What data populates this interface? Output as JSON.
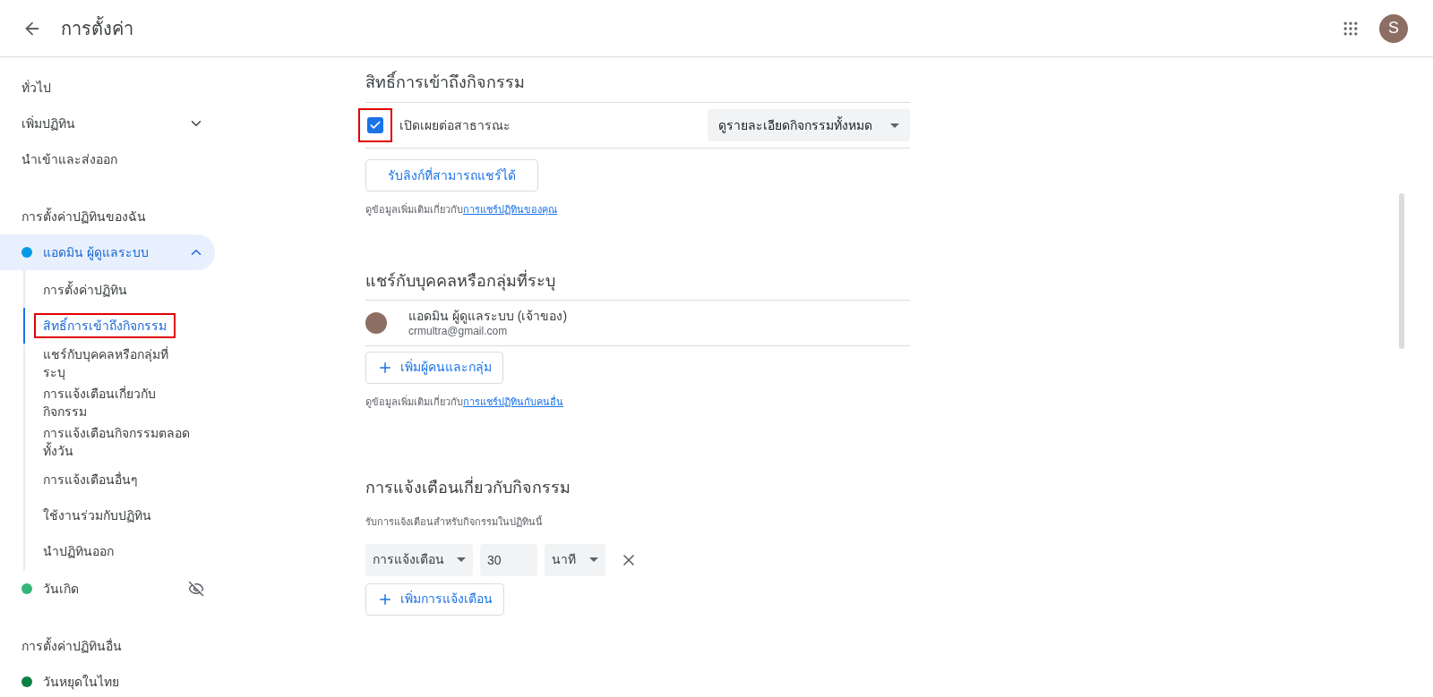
{
  "header": {
    "title": "การตั้งค่า",
    "avatar_letter": "S"
  },
  "sidebar": {
    "top_items": [
      {
        "label": "ทั่วไป",
        "expandable": false
      },
      {
        "label": "เพิ่มปฏิทิน",
        "expandable": true
      },
      {
        "label": "นำเข้าและส่งออก",
        "expandable": false
      }
    ],
    "my_calendars": {
      "heading": "การตั้งค่าปฏิทินของฉัน",
      "calendars": [
        {
          "label": "แอดมิน ผู้ดูแลระบบ",
          "color": "#039be5",
          "expanded": true,
          "hidden": false,
          "children": [
            {
              "label": "การตั้งค่าปฏิทิน",
              "selected": false,
              "highlighted": false
            },
            {
              "label": "สิทธิ์การเข้าถึงกิจกรรม",
              "selected": true,
              "highlighted": true
            },
            {
              "label": "แชร์กับบุคคลหรือกลุ่มที่ระบุ",
              "selected": false,
              "highlighted": false
            },
            {
              "label": "การแจ้งเตือนเกี่ยวกับกิจกรรม",
              "selected": false,
              "highlighted": false
            },
            {
              "label": "การแจ้งเตือนกิจกรรมตลอดทั้งวัน",
              "selected": false,
              "highlighted": false
            },
            {
              "label": "การแจ้งเตือนอื่นๆ",
              "selected": false,
              "highlighted": false
            },
            {
              "label": "ใช้งานร่วมกับปฏิทิน",
              "selected": false,
              "highlighted": false
            },
            {
              "label": "นำปฏิทินออก",
              "selected": false,
              "highlighted": false
            }
          ]
        },
        {
          "label": "วันเกิด",
          "color": "#33b679",
          "expanded": false,
          "hidden": true
        }
      ]
    },
    "other_calendars": {
      "heading": "การตั้งค่าปฏิทินอื่น",
      "calendars": [
        {
          "label": "วันหยุดในไทย",
          "color": "#0b8043"
        }
      ]
    }
  },
  "access": {
    "title": "สิทธิ์การเข้าถึงกิจกรรม",
    "public": {
      "label": "เปิดเผยต่อสาธารณะ",
      "checked": true,
      "highlighted": true
    },
    "visibility": "ดูรายละเอียดกิจกรรมทั้งหมด",
    "link_button": "รับลิงก์ที่สามารถแชร์ได้",
    "help": "ดูข้อมูลเพิ่มเติมเกี่ยวกับ",
    "help_link": "การแชร์ปฏิทินของคุณ"
  },
  "sharing": {
    "title": "แชร์กับบุคคลหรือกลุ่มที่ระบุ",
    "people": [
      {
        "name": "แอดมิน ผู้ดูแลระบบ (เจ้าของ)",
        "email": "crmultra@gmail.com"
      }
    ],
    "add_button": "เพิ่มผู้คนและกลุ่ม",
    "help": "ดูข้อมูลเพิ่มเติมเกี่ยวกับ",
    "help_link": "การแชร์ปฏิทินกับคนอื่น"
  },
  "notifications": {
    "title": "การแจ้งเตือนเกี่ยวกับกิจกรรม",
    "subtitle": "รับการแจ้งเตือนสำหรับกิจกรรมในปฏิทินนี้",
    "items": [
      {
        "type": "การแจ้งเตือน",
        "amount": "30",
        "unit": "นาที"
      }
    ],
    "add_button": "เพิ่มการแจ้งเตือน"
  }
}
